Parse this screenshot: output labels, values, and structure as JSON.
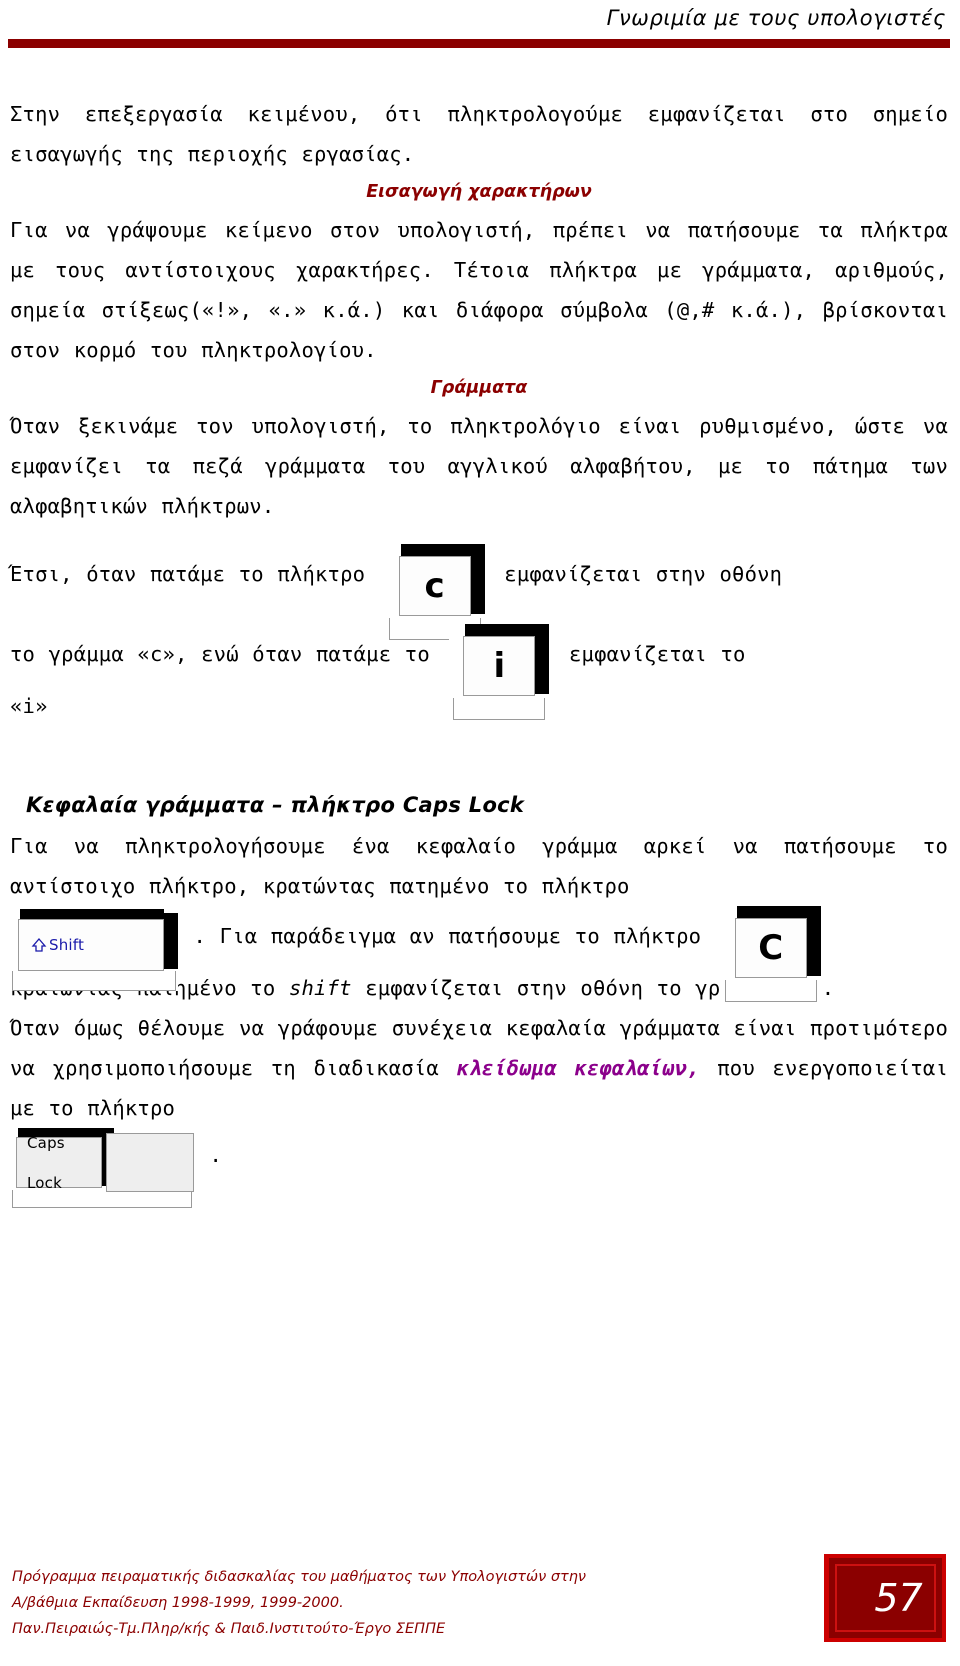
{
  "header": {
    "title": "Γνωριμία με τους υπολογιστές"
  },
  "body": {
    "intro_paragraph": "Στην επεξεργασία κειμένου, ότι πληκτρολογούμε εμφανίζεται στο σημείο εισαγωγής της περιοχής εργασίας.",
    "section1_heading": "Εισαγωγή χαρακτήρων",
    "section1_paragraph": "Για να γράψουμε κείμενο στον υπολογιστή, πρέπει να πατήσουμε τα πλήκτρα με τους αντίστοιχους χαρακτήρες. Τέτοια πλήκτρα με γράμματα, αριθμούς, σημεία στίξεως(«!», «.» κ.ά.) και διάφορα σύμβολα (@,# κ.ά.), βρίσκονται στον κορμό του πληκτρολογίου.",
    "section2_heading": "Γράμματα",
    "section2_paragraph": "Όταν ξεκινάμε τον υπολογιστή, το πληκτρολόγιο είναι ρυθμισμένο, ώστε να εμφανίζει τα πεζά γράμματα του αγγλικού αλφαβήτου, με το πάτημα των αλφαβητικών πλήκτρων.",
    "example_line1_prefix": "Έτσι, όταν πατάμε το πλήκτρο",
    "example_line1_suffix": "εμφανίζεται στην οθόνη",
    "example_line2_prefix": "το γράμμα «c», ενώ όταν πατάμε το",
    "example_line2_suffix": "εμφανίζεται το",
    "example_line3": "«i»",
    "section3_heading": "Κεφαλαία γράμματα – πλήκτρο Caps Lock",
    "section3_paragraph_a": "Για να πληκτρολογήσουμε ένα κεφαλαίο γράμμα αρκεί να πατήσουμε το αντίστοιχο πλήκτρο, κρατώντας πατημένο το πλήκτρο",
    "section3_paragraph_b": ". Για παράδειγμα αν πατήσουμε το πλήκτρο",
    "section3_paragraph_c_1": "κρατώντας πατημένο το",
    "section3_paragraph_c_shift": "shift",
    "section3_paragraph_c_2": "εμφανίζεται στην οθόνη το γράμμα «C».",
    "section3_paragraph_d_1": "Όταν όμως θέλουμε να γράφουμε συνέχεια κεφαλαία γράμματα είναι προτιμότερο να χρησιμοποιήσουμε τη διαδικασία",
    "section3_paragraph_d_highlight": "κλείδωμα κεφαλαίων,",
    "section3_paragraph_d_2": "που ενεργοποιείται με το πλήκτρο",
    "section3_paragraph_e": "."
  },
  "keys": {
    "key_c_lower": "c",
    "key_i_lower": "i",
    "key_c_upper": "C",
    "key_shift": "Shift",
    "key_caps_lock": "Caps Lock"
  },
  "footer": {
    "line1": "Πρόγραμμα πειραματικής διδασκαλίας του μαθήματος των Υπολογιστών στην",
    "line2": "Α/βάθμια Εκπαίδευση 1998-1999, 1999-2000.",
    "line3": "Παν.Πειραιώς-Τμ.Πληρ/κής & Παιδ.Ινστιτούτο-Έργο ΣΕΠΠΕ",
    "page_number": "57"
  },
  "colors": {
    "accent_dark_red": "#8B0000",
    "accent_bright_red": "#CC0000",
    "highlight_purple": "#8B008B",
    "shift_label_blue": "#1a1aaa"
  }
}
